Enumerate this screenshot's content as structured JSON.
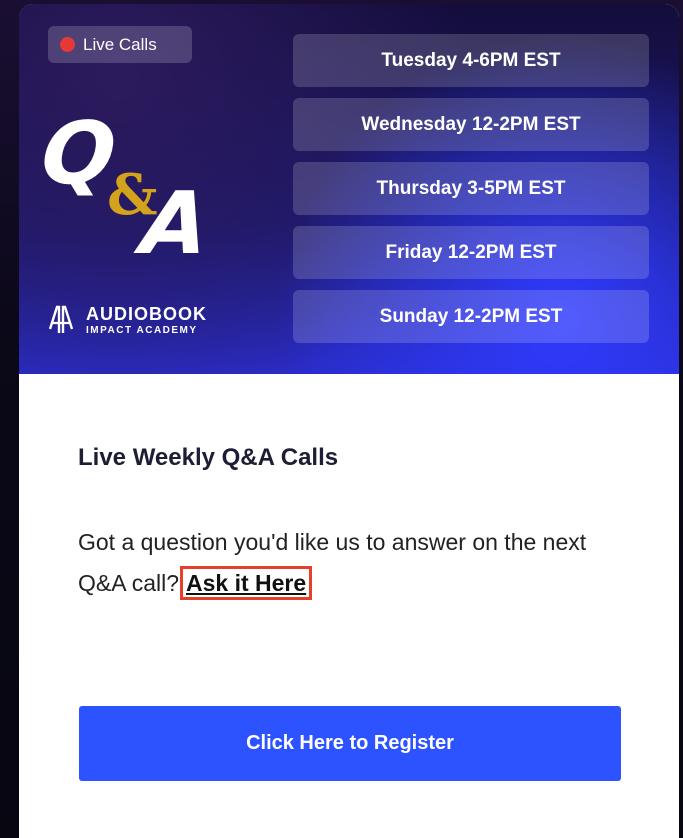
{
  "banner": {
    "live_label": "Live Calls",
    "live_dot_color": "#e53935",
    "qa_q": "Q",
    "qa_amp": "&",
    "qa_a": "A",
    "qa_amp_color": "#d4a21b",
    "logo_main": "AUDIOBOOK",
    "logo_sub": "IMPACT ACADEMY",
    "logo_icon": "audiobook-logo-icon",
    "schedule": [
      "Tuesday 4-6PM EST",
      "Wednesday 12-2PM EST",
      "Thursday 3-5PM EST",
      "Friday 12-2PM EST",
      "Sunday 12-2PM EST"
    ]
  },
  "content": {
    "title": "Live Weekly Q&A Calls",
    "text_before_link": "Got a question you'd like us to answer on the next Q&A call?",
    "link_label": "Ask it Here",
    "highlight_color": "#e6402a",
    "cta_label": "Click Here to Register",
    "cta_color": "#2d52ff"
  }
}
